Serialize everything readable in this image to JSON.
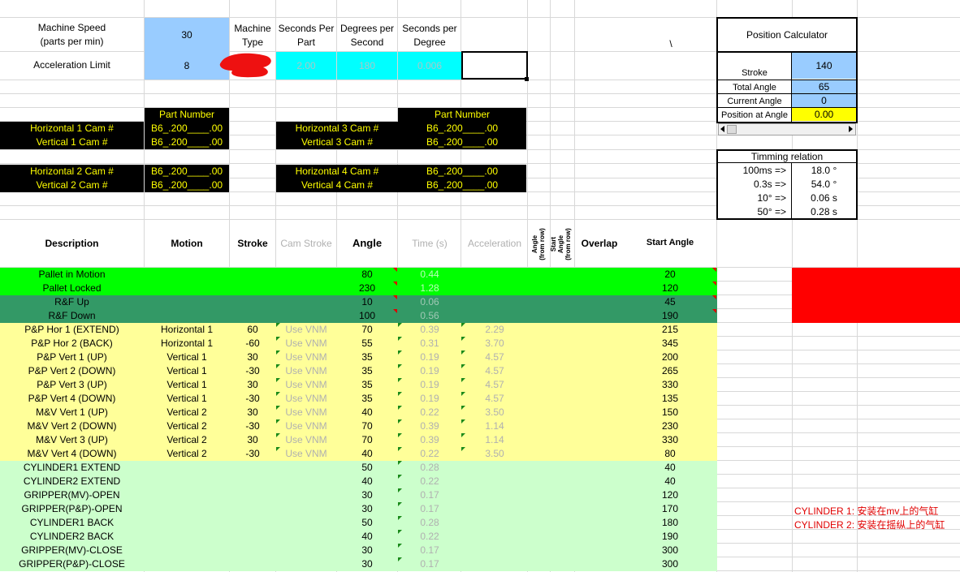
{
  "top": {
    "machine_speed_label": "Machine Speed\n(parts per min)",
    "machine_speed_value": "30",
    "accel_limit_label": "Acceleration Limit",
    "accel_limit_value": "8",
    "machine_type_label": "Machine Type",
    "seconds_per_part_label": "Seconds Per Part",
    "degrees_per_second_label": "Degrees per Second",
    "seconds_per_degree_label": "Seconds per Degree",
    "seconds_per_part_value": "2.00",
    "degrees_per_second_value": "180",
    "seconds_per_degree_value": "0.006",
    "stray_mark": "\\"
  },
  "cams": {
    "part_number_label": "Part Number",
    "h1": "Horizontal 1 Cam #",
    "v1": "Vertical 1 Cam #",
    "h2": "Horizontal 2 Cam #",
    "v2": "Vertical 2 Cam #",
    "h3": "Horizontal 3 Cam #",
    "v3": "Vertical 3 Cam #",
    "h4": "Horizontal 4 Cam #",
    "v4": "Vertical 4 Cam #",
    "pn": "B6_.200____.00"
  },
  "calculator": {
    "title": "Position Calculator",
    "stroke_label": "Stroke",
    "stroke_value": "140",
    "total_angle_label": "Total Angle",
    "total_angle_value": "65",
    "current_angle_label": "Current Angle",
    "current_angle_value": "0",
    "position_label": "Position at Angle",
    "position_value": "0.00"
  },
  "timing": {
    "title": "Timming relation",
    "rows": [
      {
        "k": "100ms =>",
        "v": "18.0 °"
      },
      {
        "k": "0.3s =>",
        "v": "54.0 °"
      },
      {
        "k": "10° =>",
        "v": "0.06 s"
      },
      {
        "k": "50° =>",
        "v": "0.28 s"
      }
    ]
  },
  "table": {
    "headers": {
      "description": "Description",
      "motion": "Motion",
      "stroke": "Stroke",
      "cam_stroke": "Cam Stroke",
      "angle": "Angle",
      "time": "Time (s)",
      "acceleration": "Acceleration",
      "angle_from_row": "Angle\n(from row)",
      "start_angle_from_row": "Start\nAngle\n(from row)",
      "overlap": "Overlap",
      "start_angle": "Start Angle"
    },
    "rows": [
      {
        "desc": "Pallet in Motion",
        "motion": "",
        "stroke": "",
        "cam": "",
        "angle": "80",
        "time": "0.44",
        "accel": "",
        "start": "20",
        "bg": "#00ff00"
      },
      {
        "desc": "Pallet Locked",
        "motion": "",
        "stroke": "",
        "cam": "",
        "angle": "230",
        "time": "1.28",
        "accel": "",
        "start": "120",
        "bg": "#00ff00"
      },
      {
        "desc": "R&F Up",
        "motion": "",
        "stroke": "",
        "cam": "",
        "angle": "10",
        "time": "0.06",
        "accel": "",
        "start": "45",
        "bg": "#339966"
      },
      {
        "desc": "R&F Down",
        "motion": "",
        "stroke": "",
        "cam": "",
        "angle": "100",
        "time": "0.56",
        "accel": "",
        "start": "190",
        "bg": "#339966"
      },
      {
        "desc": "P&P Hor 1 (EXTEND)",
        "motion": "Horizontal 1",
        "stroke": "60",
        "cam": "Use VNM",
        "angle": "70",
        "time": "0.39",
        "accel": "2.29",
        "start": "215",
        "bg": "#ffff99"
      },
      {
        "desc": "P&P Hor 2 (BACK)",
        "motion": "Horizontal 1",
        "stroke": "-60",
        "cam": "Use VNM",
        "angle": "55",
        "time": "0.31",
        "accel": "3.70",
        "start": "345",
        "bg": "#ffff99"
      },
      {
        "desc": "P&P Vert 1 (UP)",
        "motion": "Vertical 1",
        "stroke": "30",
        "cam": "Use VNM",
        "angle": "35",
        "time": "0.19",
        "accel": "4.57",
        "start": "200",
        "bg": "#ffff99"
      },
      {
        "desc": "P&P Vert 2 (DOWN)",
        "motion": "Vertical 1",
        "stroke": "-30",
        "cam": "Use VNM",
        "angle": "35",
        "time": "0.19",
        "accel": "4.57",
        "start": "265",
        "bg": "#ffff99"
      },
      {
        "desc": "P&P Vert 3 (UP)",
        "motion": "Vertical 1",
        "stroke": "30",
        "cam": "Use VNM",
        "angle": "35",
        "time": "0.19",
        "accel": "4.57",
        "start": "330",
        "bg": "#ffff99"
      },
      {
        "desc": "P&P Vert 4 (DOWN)",
        "motion": "Vertical 1",
        "stroke": "-30",
        "cam": "Use VNM",
        "angle": "35",
        "time": "0.19",
        "accel": "4.57",
        "start": "135",
        "bg": "#ffff99"
      },
      {
        "desc": "M&V Vert 1 (UP)",
        "motion": "Vertical 2",
        "stroke": "30",
        "cam": "Use VNM",
        "angle": "40",
        "time": "0.22",
        "accel": "3.50",
        "start": "150",
        "bg": "#ffff99"
      },
      {
        "desc": "M&V Vert 2 (DOWN)",
        "motion": "Vertical 2",
        "stroke": "-30",
        "cam": "Use VNM",
        "angle": "70",
        "time": "0.39",
        "accel": "1.14",
        "start": "230",
        "bg": "#ffff99"
      },
      {
        "desc": "M&V Vert 3 (UP)",
        "motion": "Vertical 2",
        "stroke": "30",
        "cam": "Use VNM",
        "angle": "70",
        "time": "0.39",
        "accel": "1.14",
        "start": "330",
        "bg": "#ffff99"
      },
      {
        "desc": "M&V Vert 4 (DOWN)",
        "motion": "Vertical 2",
        "stroke": "-30",
        "cam": "Use VNM",
        "angle": "40",
        "time": "0.22",
        "accel": "3.50",
        "start": "80",
        "bg": "#ffff99"
      },
      {
        "desc": "CYLINDER1 EXTEND",
        "motion": "",
        "stroke": "",
        "cam": "",
        "angle": "50",
        "time": "0.28",
        "accel": "",
        "start": "40",
        "bg": "#ccffcc"
      },
      {
        "desc": "CYLINDER2 EXTEND",
        "motion": "",
        "stroke": "",
        "cam": "",
        "angle": "40",
        "time": "0.22",
        "accel": "",
        "start": "40",
        "bg": "#ccffcc"
      },
      {
        "desc": "GRIPPER(MV)-OPEN",
        "motion": "",
        "stroke": "",
        "cam": "",
        "angle": "30",
        "time": "0.17",
        "accel": "",
        "start": "120",
        "bg": "#ccffcc"
      },
      {
        "desc": "GRIPPER(P&P)-OPEN",
        "motion": "",
        "stroke": "",
        "cam": "",
        "angle": "30",
        "time": "0.17",
        "accel": "",
        "start": "170",
        "bg": "#ccffcc"
      },
      {
        "desc": "CYLINDER1 BACK",
        "motion": "",
        "stroke": "",
        "cam": "",
        "angle": "50",
        "time": "0.28",
        "accel": "",
        "start": "180",
        "bg": "#ccffcc"
      },
      {
        "desc": "CYLINDER2 BACK",
        "motion": "",
        "stroke": "",
        "cam": "",
        "angle": "40",
        "time": "0.22",
        "accel": "",
        "start": "190",
        "bg": "#ccffcc"
      },
      {
        "desc": "GRIPPER(MV)-CLOSE",
        "motion": "",
        "stroke": "",
        "cam": "",
        "angle": "30",
        "time": "0.17",
        "accel": "",
        "start": "300",
        "bg": "#ccffcc"
      },
      {
        "desc": "GRIPPER(P&P)-CLOSE",
        "motion": "",
        "stroke": "",
        "cam": "",
        "angle": "30",
        "time": "0.17",
        "accel": "",
        "start": "300",
        "bg": "#ccffcc"
      }
    ]
  },
  "notes": {
    "cyl1": "CYLINDER 1: 安装在mv上的气缸",
    "cyl2": "CYLINDER 2: 安装在摇纵上的气缸"
  },
  "colors": {
    "input_blue": "#99ccff",
    "cyan": "#00ffff",
    "bright_green": "#00ff00",
    "sea_green": "#339966",
    "light_yellow": "#ffff99",
    "light_green": "#ccffcc",
    "alert_red": "#ff0000",
    "cam_text_yellow": "#ffff00"
  }
}
